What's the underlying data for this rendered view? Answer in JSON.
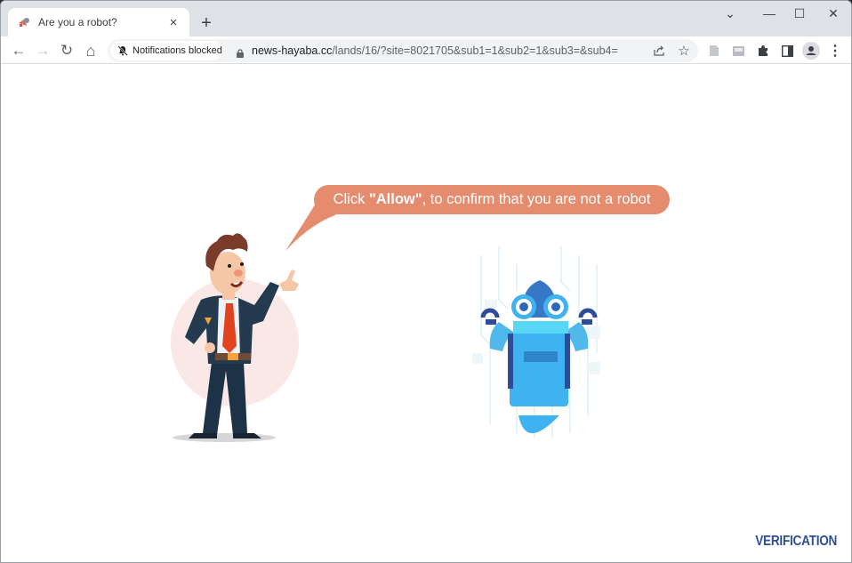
{
  "browser": {
    "tab": {
      "title": "Are you a robot?",
      "favicon": "robot-megaphone-icon",
      "close": "×"
    },
    "new_tab_label": "+",
    "window_controls": {
      "tab_search": "⌄",
      "minimize": "—",
      "maximize": "☐",
      "close": "✕"
    },
    "nav": {
      "back": "←",
      "forward": "→",
      "reload": "↻",
      "home": "⌂"
    },
    "notification_chip": "Notifications blocked",
    "url": {
      "host": "news-hayaba.cc",
      "path": "/lands/16/?site=8021705&sub1=1&sub2=1&sub3=&sub4="
    },
    "toolbar_icons": [
      "share-icon",
      "bookmark-star-icon",
      "document-icon",
      "inbox-icon",
      "extensions-icon",
      "side-panel-icon",
      "profile-icon",
      "menu-icon"
    ]
  },
  "page": {
    "bubble": {
      "prefix": "Click ",
      "highlight": "\"Allow\"",
      "suffix": ", to confirm that you are not a robot"
    },
    "brand": "VERIFICATION",
    "colors": {
      "bubble": "#e48c6d",
      "brand": "#2e4f97",
      "robot": "#3fb3ef"
    }
  }
}
